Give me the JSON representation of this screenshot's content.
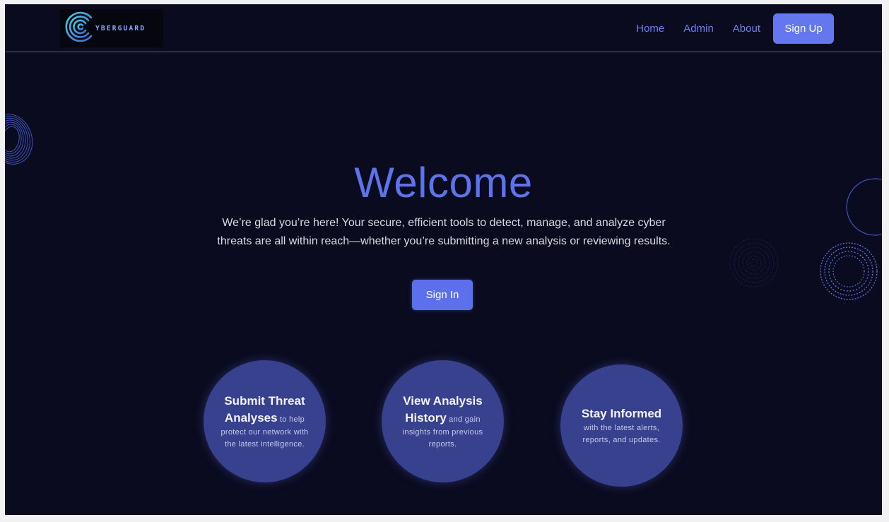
{
  "brand": {
    "logo_text": "YBERGUARD",
    "logo_icon": "cyberguard-c-logo-icon"
  },
  "nav": {
    "links": [
      "Home",
      "Admin",
      "About"
    ],
    "signup_label": "Sign Up"
  },
  "hero": {
    "title": "Welcome",
    "intro": "We’re glad you’re here! Your secure, efficient tools to detect, manage, and analyze cyber threats are all within reach—whether you’re submitting a new analysis or reviewing results.",
    "signin_label": "Sign In"
  },
  "cards": [
    {
      "title": "Submit Threat Analyses",
      "body": " to help protect our network with the latest intelligence."
    },
    {
      "title": "View Analysis History",
      "body": " and gain insights from previous reports."
    },
    {
      "title": "Stay Informed",
      "body": " with the latest alerts, reports, and updates."
    }
  ],
  "colors": {
    "background": "#0a0b1f",
    "accent": "#6477ee",
    "card": "#37418e",
    "nav_link": "#6b7ff0"
  }
}
